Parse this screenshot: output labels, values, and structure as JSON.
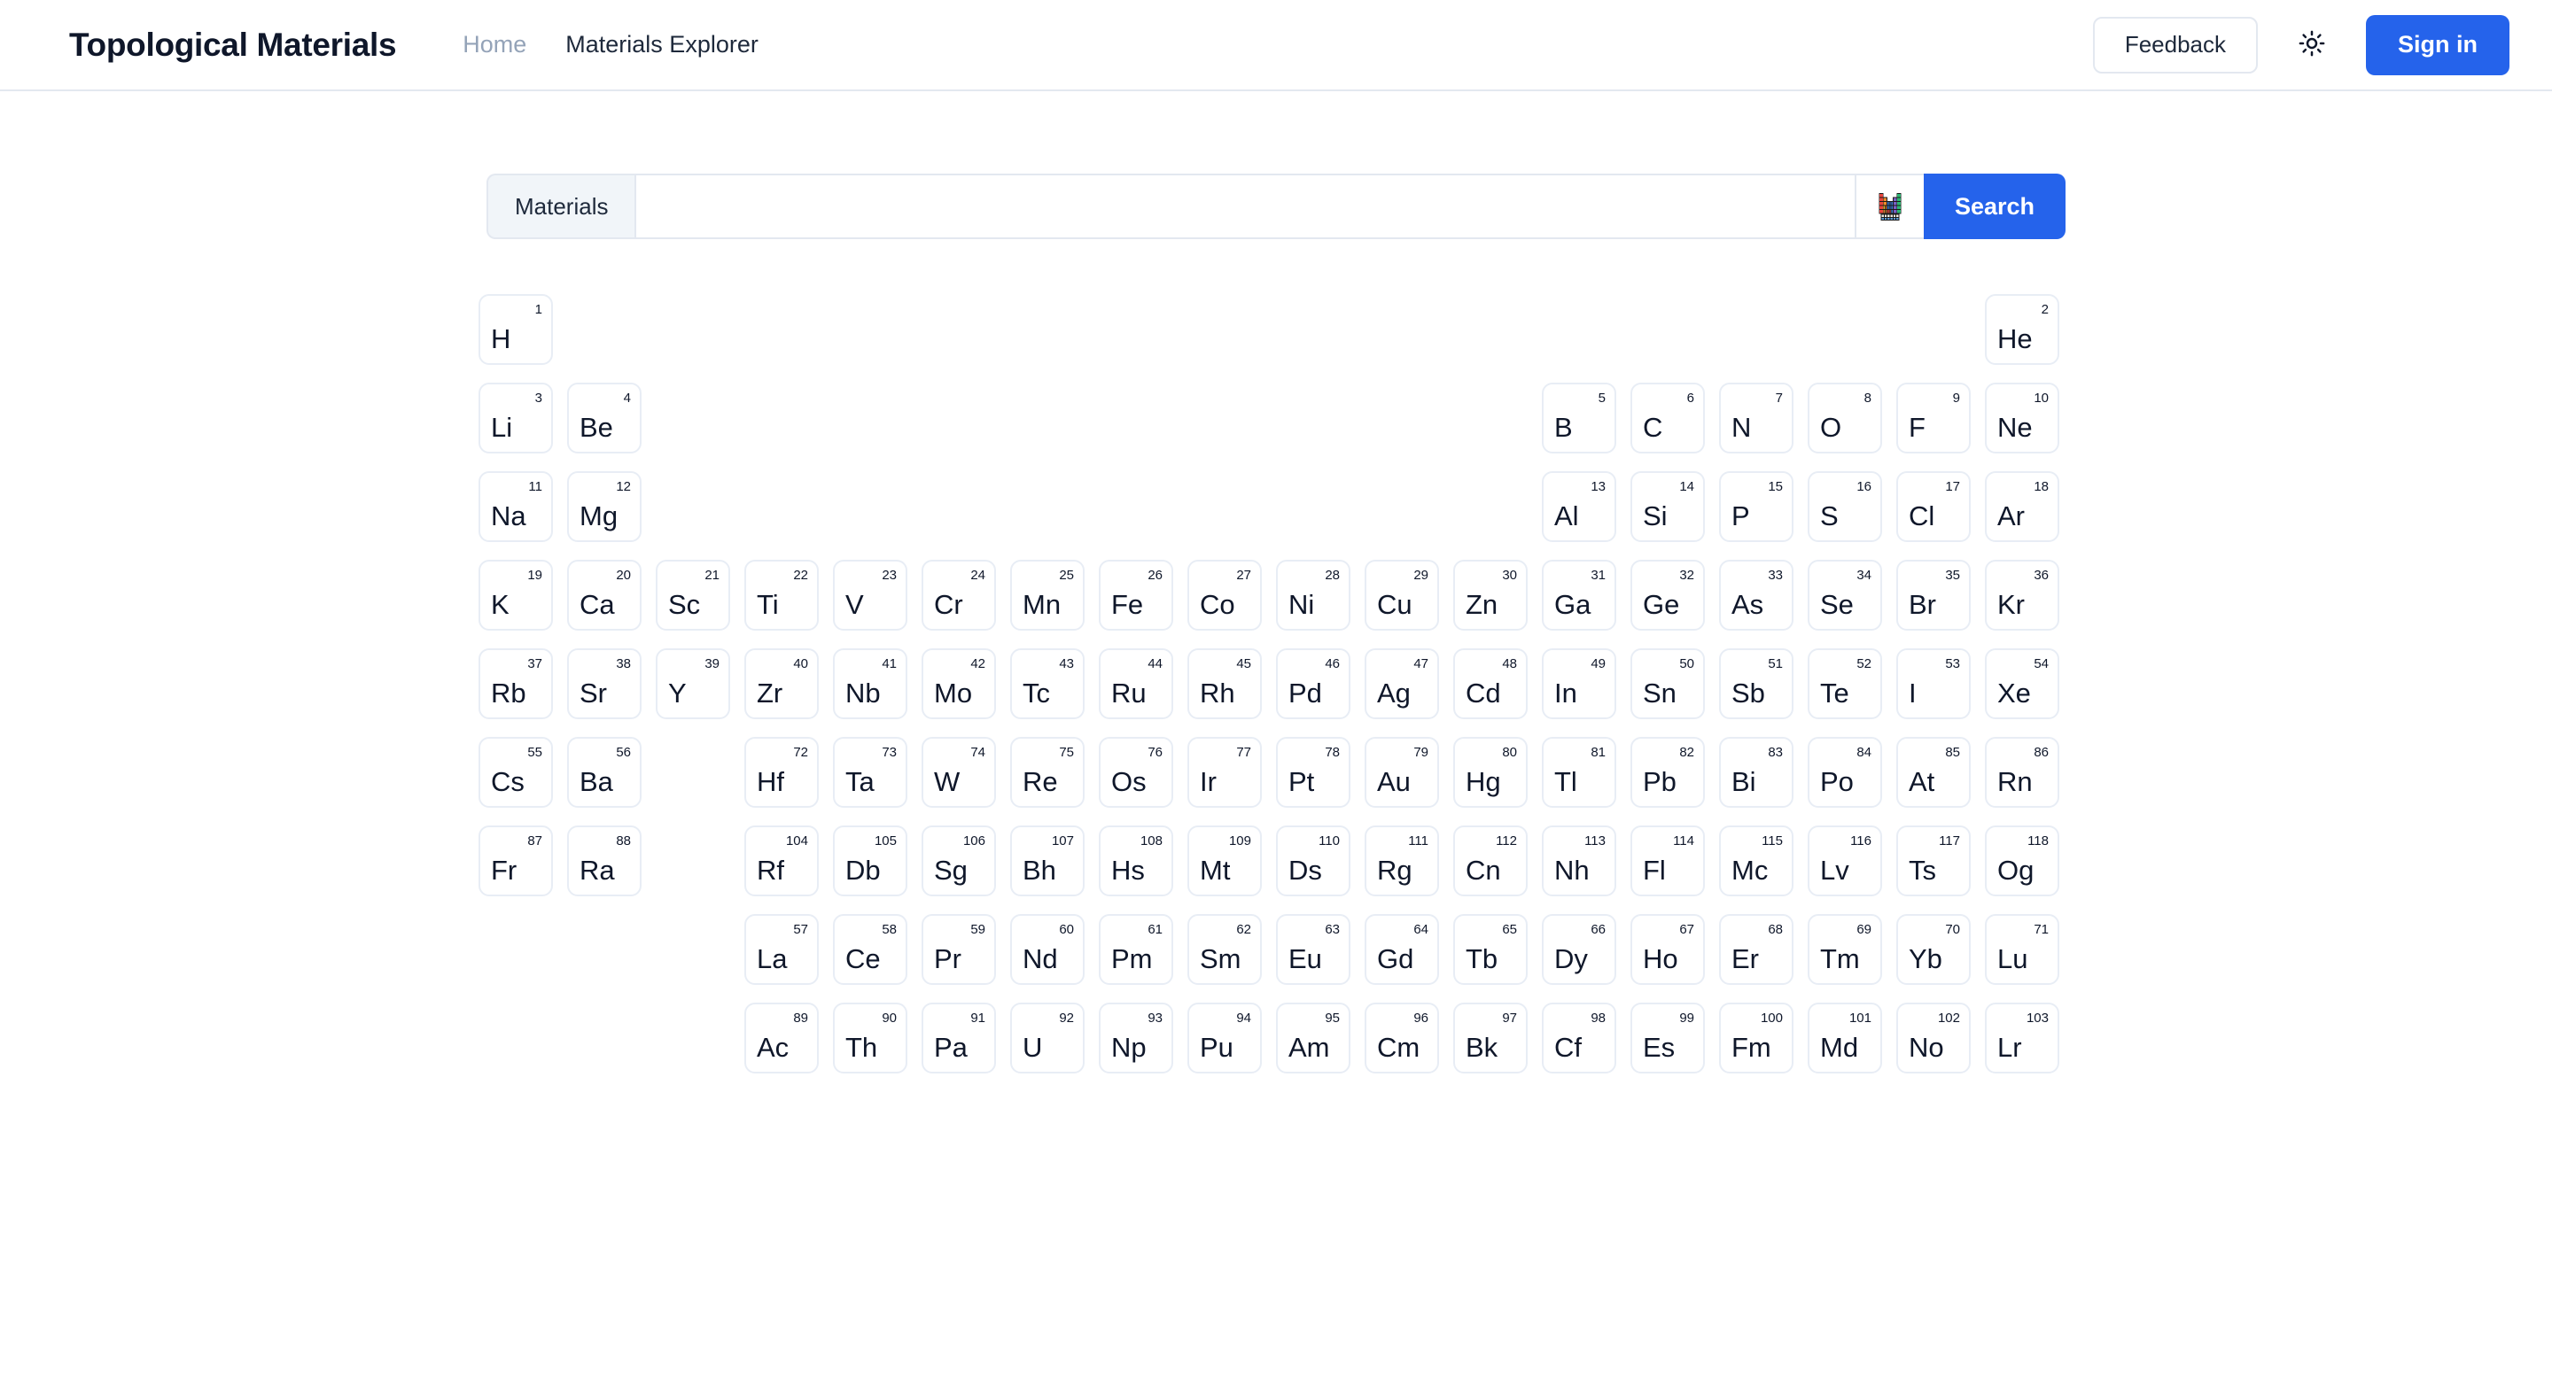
{
  "header": {
    "brand": "Topological Materials",
    "nav": [
      {
        "label": "Home",
        "state": "muted"
      },
      {
        "label": "Materials Explorer",
        "state": "dark"
      }
    ],
    "feedback_label": "Feedback",
    "theme_icon": "sun-icon",
    "signin_label": "Sign in",
    "accent_color": "#2563eb",
    "border_color": "#e3e8f0"
  },
  "search": {
    "prefix_label": "Materials",
    "value": "",
    "placeholder": "",
    "ptable_icon": "periodic-table-icon",
    "button_label": "Search"
  },
  "periodic_table": {
    "elements": [
      {
        "symbol": "H",
        "number": "1",
        "row": 1,
        "col": 1
      },
      {
        "symbol": "He",
        "number": "2",
        "row": 1,
        "col": 18
      },
      {
        "symbol": "Li",
        "number": "3",
        "row": 2,
        "col": 1
      },
      {
        "symbol": "Be",
        "number": "4",
        "row": 2,
        "col": 2
      },
      {
        "symbol": "B",
        "number": "5",
        "row": 2,
        "col": 13
      },
      {
        "symbol": "C",
        "number": "6",
        "row": 2,
        "col": 14
      },
      {
        "symbol": "N",
        "number": "7",
        "row": 2,
        "col": 15
      },
      {
        "symbol": "O",
        "number": "8",
        "row": 2,
        "col": 16
      },
      {
        "symbol": "F",
        "number": "9",
        "row": 2,
        "col": 17
      },
      {
        "symbol": "Ne",
        "number": "10",
        "row": 2,
        "col": 18
      },
      {
        "symbol": "Na",
        "number": "11",
        "row": 3,
        "col": 1
      },
      {
        "symbol": "Mg",
        "number": "12",
        "row": 3,
        "col": 2
      },
      {
        "symbol": "Al",
        "number": "13",
        "row": 3,
        "col": 13
      },
      {
        "symbol": "Si",
        "number": "14",
        "row": 3,
        "col": 14
      },
      {
        "symbol": "P",
        "number": "15",
        "row": 3,
        "col": 15
      },
      {
        "symbol": "S",
        "number": "16",
        "row": 3,
        "col": 16
      },
      {
        "symbol": "Cl",
        "number": "17",
        "row": 3,
        "col": 17
      },
      {
        "symbol": "Ar",
        "number": "18",
        "row": 3,
        "col": 18
      },
      {
        "symbol": "K",
        "number": "19",
        "row": 4,
        "col": 1
      },
      {
        "symbol": "Ca",
        "number": "20",
        "row": 4,
        "col": 2
      },
      {
        "symbol": "Sc",
        "number": "21",
        "row": 4,
        "col": 3
      },
      {
        "symbol": "Ti",
        "number": "22",
        "row": 4,
        "col": 4
      },
      {
        "symbol": "V",
        "number": "23",
        "row": 4,
        "col": 5
      },
      {
        "symbol": "Cr",
        "number": "24",
        "row": 4,
        "col": 6
      },
      {
        "symbol": "Mn",
        "number": "25",
        "row": 4,
        "col": 7
      },
      {
        "symbol": "Fe",
        "number": "26",
        "row": 4,
        "col": 8
      },
      {
        "symbol": "Co",
        "number": "27",
        "row": 4,
        "col": 9
      },
      {
        "symbol": "Ni",
        "number": "28",
        "row": 4,
        "col": 10
      },
      {
        "symbol": "Cu",
        "number": "29",
        "row": 4,
        "col": 11
      },
      {
        "symbol": "Zn",
        "number": "30",
        "row": 4,
        "col": 12
      },
      {
        "symbol": "Ga",
        "number": "31",
        "row": 4,
        "col": 13
      },
      {
        "symbol": "Ge",
        "number": "32",
        "row": 4,
        "col": 14
      },
      {
        "symbol": "As",
        "number": "33",
        "row": 4,
        "col": 15
      },
      {
        "symbol": "Se",
        "number": "34",
        "row": 4,
        "col": 16
      },
      {
        "symbol": "Br",
        "number": "35",
        "row": 4,
        "col": 17
      },
      {
        "symbol": "Kr",
        "number": "36",
        "row": 4,
        "col": 18
      },
      {
        "symbol": "Rb",
        "number": "37",
        "row": 5,
        "col": 1
      },
      {
        "symbol": "Sr",
        "number": "38",
        "row": 5,
        "col": 2
      },
      {
        "symbol": "Y",
        "number": "39",
        "row": 5,
        "col": 3
      },
      {
        "symbol": "Zr",
        "number": "40",
        "row": 5,
        "col": 4
      },
      {
        "symbol": "Nb",
        "number": "41",
        "row": 5,
        "col": 5
      },
      {
        "symbol": "Mo",
        "number": "42",
        "row": 5,
        "col": 6
      },
      {
        "symbol": "Tc",
        "number": "43",
        "row": 5,
        "col": 7
      },
      {
        "symbol": "Ru",
        "number": "44",
        "row": 5,
        "col": 8
      },
      {
        "symbol": "Rh",
        "number": "45",
        "row": 5,
        "col": 9
      },
      {
        "symbol": "Pd",
        "number": "46",
        "row": 5,
        "col": 10
      },
      {
        "symbol": "Ag",
        "number": "47",
        "row": 5,
        "col": 11
      },
      {
        "symbol": "Cd",
        "number": "48",
        "row": 5,
        "col": 12
      },
      {
        "symbol": "In",
        "number": "49",
        "row": 5,
        "col": 13
      },
      {
        "symbol": "Sn",
        "number": "50",
        "row": 5,
        "col": 14
      },
      {
        "symbol": "Sb",
        "number": "51",
        "row": 5,
        "col": 15
      },
      {
        "symbol": "Te",
        "number": "52",
        "row": 5,
        "col": 16
      },
      {
        "symbol": "I",
        "number": "53",
        "row": 5,
        "col": 17
      },
      {
        "symbol": "Xe",
        "number": "54",
        "row": 5,
        "col": 18
      },
      {
        "symbol": "Cs",
        "number": "55",
        "row": 6,
        "col": 1
      },
      {
        "symbol": "Ba",
        "number": "56",
        "row": 6,
        "col": 2
      },
      {
        "symbol": "Hf",
        "number": "72",
        "row": 6,
        "col": 4
      },
      {
        "symbol": "Ta",
        "number": "73",
        "row": 6,
        "col": 5
      },
      {
        "symbol": "W",
        "number": "74",
        "row": 6,
        "col": 6
      },
      {
        "symbol": "Re",
        "number": "75",
        "row": 6,
        "col": 7
      },
      {
        "symbol": "Os",
        "number": "76",
        "row": 6,
        "col": 8
      },
      {
        "symbol": "Ir",
        "number": "77",
        "row": 6,
        "col": 9
      },
      {
        "symbol": "Pt",
        "number": "78",
        "row": 6,
        "col": 10
      },
      {
        "symbol": "Au",
        "number": "79",
        "row": 6,
        "col": 11
      },
      {
        "symbol": "Hg",
        "number": "80",
        "row": 6,
        "col": 12
      },
      {
        "symbol": "Tl",
        "number": "81",
        "row": 6,
        "col": 13
      },
      {
        "symbol": "Pb",
        "number": "82",
        "row": 6,
        "col": 14
      },
      {
        "symbol": "Bi",
        "number": "83",
        "row": 6,
        "col": 15
      },
      {
        "symbol": "Po",
        "number": "84",
        "row": 6,
        "col": 16
      },
      {
        "symbol": "At",
        "number": "85",
        "row": 6,
        "col": 17
      },
      {
        "symbol": "Rn",
        "number": "86",
        "row": 6,
        "col": 18
      },
      {
        "symbol": "Fr",
        "number": "87",
        "row": 7,
        "col": 1
      },
      {
        "symbol": "Ra",
        "number": "88",
        "row": 7,
        "col": 2
      },
      {
        "symbol": "Rf",
        "number": "104",
        "row": 7,
        "col": 4
      },
      {
        "symbol": "Db",
        "number": "105",
        "row": 7,
        "col": 5
      },
      {
        "symbol": "Sg",
        "number": "106",
        "row": 7,
        "col": 6
      },
      {
        "symbol": "Bh",
        "number": "107",
        "row": 7,
        "col": 7
      },
      {
        "symbol": "Hs",
        "number": "108",
        "row": 7,
        "col": 8
      },
      {
        "symbol": "Mt",
        "number": "109",
        "row": 7,
        "col": 9
      },
      {
        "symbol": "Ds",
        "number": "110",
        "row": 7,
        "col": 10
      },
      {
        "symbol": "Rg",
        "number": "111",
        "row": 7,
        "col": 11
      },
      {
        "symbol": "Cn",
        "number": "112",
        "row": 7,
        "col": 12
      },
      {
        "symbol": "Nh",
        "number": "113",
        "row": 7,
        "col": 13
      },
      {
        "symbol": "Fl",
        "number": "114",
        "row": 7,
        "col": 14
      },
      {
        "symbol": "Mc",
        "number": "115",
        "row": 7,
        "col": 15
      },
      {
        "symbol": "Lv",
        "number": "116",
        "row": 7,
        "col": 16
      },
      {
        "symbol": "Ts",
        "number": "117",
        "row": 7,
        "col": 17
      },
      {
        "symbol": "Og",
        "number": "118",
        "row": 7,
        "col": 18
      },
      {
        "symbol": "La",
        "number": "57",
        "row": 8,
        "col": 4
      },
      {
        "symbol": "Ce",
        "number": "58",
        "row": 8,
        "col": 5
      },
      {
        "symbol": "Pr",
        "number": "59",
        "row": 8,
        "col": 6
      },
      {
        "symbol": "Nd",
        "number": "60",
        "row": 8,
        "col": 7
      },
      {
        "symbol": "Pm",
        "number": "61",
        "row": 8,
        "col": 8
      },
      {
        "symbol": "Sm",
        "number": "62",
        "row": 8,
        "col": 9
      },
      {
        "symbol": "Eu",
        "number": "63",
        "row": 8,
        "col": 10
      },
      {
        "symbol": "Gd",
        "number": "64",
        "row": 8,
        "col": 11
      },
      {
        "symbol": "Tb",
        "number": "65",
        "row": 8,
        "col": 12
      },
      {
        "symbol": "Dy",
        "number": "66",
        "row": 8,
        "col": 13
      },
      {
        "symbol": "Ho",
        "number": "67",
        "row": 8,
        "col": 14
      },
      {
        "symbol": "Er",
        "number": "68",
        "row": 8,
        "col": 15
      },
      {
        "symbol": "Tm",
        "number": "69",
        "row": 8,
        "col": 16
      },
      {
        "symbol": "Yb",
        "number": "70",
        "row": 8,
        "col": 17
      },
      {
        "symbol": "Lu",
        "number": "71",
        "row": 8,
        "col": 18
      },
      {
        "symbol": "Ac",
        "number": "89",
        "row": 9,
        "col": 4
      },
      {
        "symbol": "Th",
        "number": "90",
        "row": 9,
        "col": 5
      },
      {
        "symbol": "Pa",
        "number": "91",
        "row": 9,
        "col": 6
      },
      {
        "symbol": "U",
        "number": "92",
        "row": 9,
        "col": 7
      },
      {
        "symbol": "Np",
        "number": "93",
        "row": 9,
        "col": 8
      },
      {
        "symbol": "Pu",
        "number": "94",
        "row": 9,
        "col": 9
      },
      {
        "symbol": "Am",
        "number": "95",
        "row": 9,
        "col": 10
      },
      {
        "symbol": "Cm",
        "number": "96",
        "row": 9,
        "col": 11
      },
      {
        "symbol": "Bk",
        "number": "97",
        "row": 9,
        "col": 12
      },
      {
        "symbol": "Cf",
        "number": "98",
        "row": 9,
        "col": 13
      },
      {
        "symbol": "Es",
        "number": "99",
        "row": 9,
        "col": 14
      },
      {
        "symbol": "Fm",
        "number": "100",
        "row": 9,
        "col": 15
      },
      {
        "symbol": "Md",
        "number": "101",
        "row": 9,
        "col": 16
      },
      {
        "symbol": "No",
        "number": "102",
        "row": 9,
        "col": 17
      },
      {
        "symbol": "Lr",
        "number": "103",
        "row": 9,
        "col": 18
      }
    ]
  }
}
